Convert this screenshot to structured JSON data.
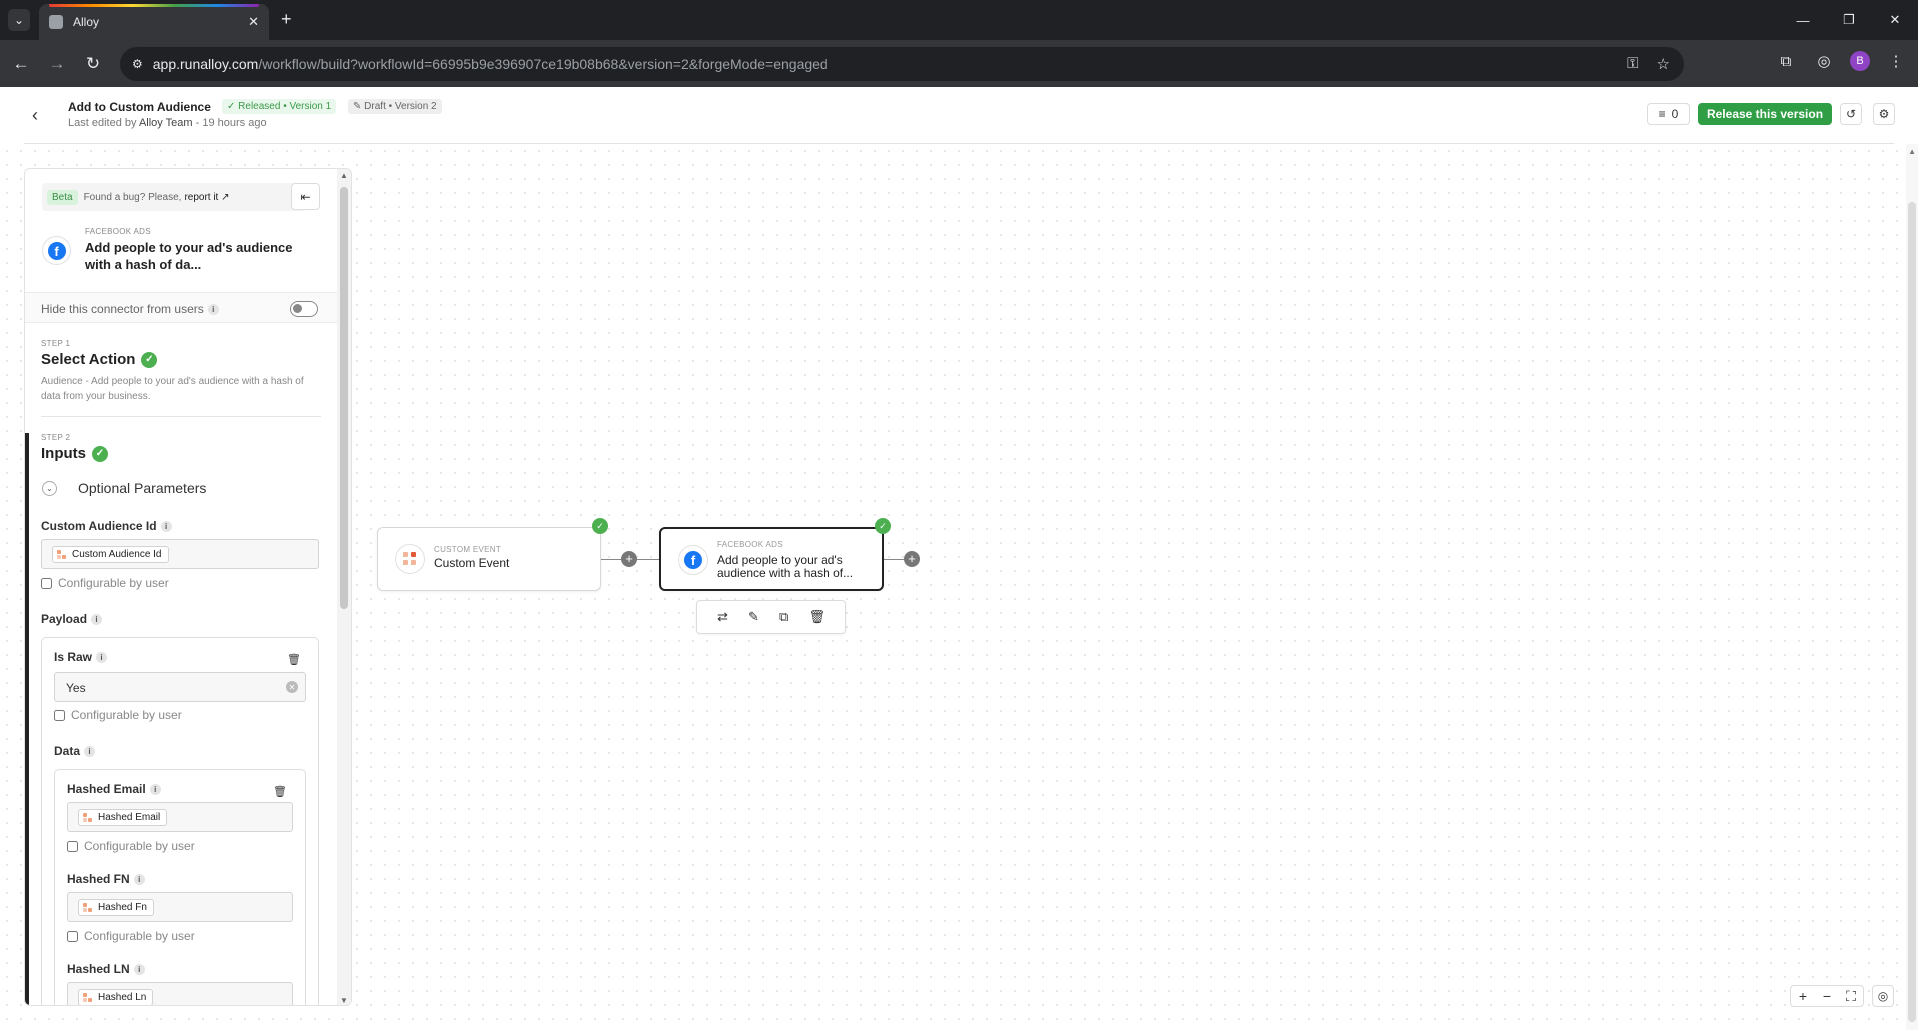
{
  "browser": {
    "tab_title": "Alloy",
    "url_host": "app.runalloy.com",
    "url_rest": "/workflow/build?workflowId=66995b9e396907ce19b08b68&version=2&forgeMode=engaged",
    "profile_initial": "B"
  },
  "header": {
    "title": "Add to Custom Audience",
    "released_badge": "Released • Version 1",
    "draft_badge": "Draft • Version 2",
    "last_edited_prefix": "Last edited by",
    "last_edited_user": "Alloy Team",
    "last_edited_suffix": "- 19 hours ago",
    "logs_count": "0",
    "release_button": "Release this version"
  },
  "panel": {
    "beta_badge": "Beta",
    "beta_text": "Found a bug? Please,",
    "beta_link": "report it",
    "connector_kicker": "FACEBOOK ADS",
    "connector_name": "Add people to your ad's audience with a hash of da...",
    "hide_label": "Hide this connector from users",
    "step1": {
      "label": "STEP 1",
      "title": "Select Action",
      "desc": "Audience - Add people to your ad's audience with a hash of data from your business."
    },
    "step2": {
      "label": "STEP 2",
      "title": "Inputs"
    },
    "optional_label": "Optional Parameters",
    "configurable_label": "Configurable by user",
    "custom_audience_label": "Custom Audience Id",
    "custom_audience_chip": "Custom Audience Id",
    "payload_label": "Payload",
    "is_raw_label": "Is Raw",
    "is_raw_value": "Yes",
    "data_label": "Data",
    "hashed_email_label": "Hashed Email",
    "hashed_email_chip": "Hashed Email",
    "hashed_fn_label": "Hashed FN",
    "hashed_fn_chip": "Hashed Fn",
    "hashed_ln_label": "Hashed LN",
    "hashed_ln_chip": "Hashed Ln"
  },
  "flow": {
    "node1": {
      "kicker": "CUSTOM EVENT",
      "title": "Custom Event"
    },
    "node2": {
      "kicker": "FACEBOOK ADS",
      "title": "Add people to your ad's audience with a hash of..."
    }
  },
  "colors": {
    "accent_green": "#2f9e44",
    "facebook_blue": "#1877f2"
  }
}
